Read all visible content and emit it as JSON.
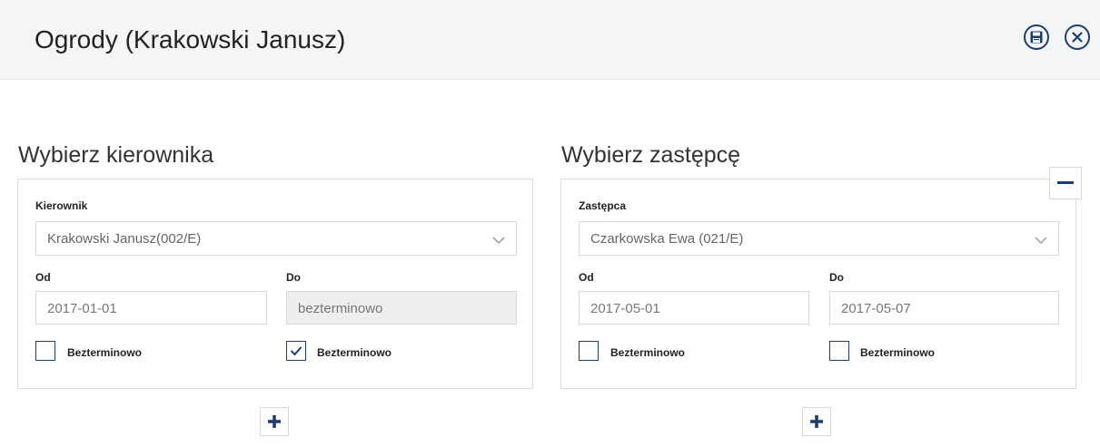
{
  "header": {
    "title": "Ogrody (Krakowski Janusz)",
    "save_icon": "floppy-disk-icon",
    "close_icon": "close-icon"
  },
  "manager": {
    "section_title": "Wybierz kierownika",
    "select_label": "Kierownik",
    "select_value": "Krakowski Janusz(002/E)",
    "from_label": "Od",
    "from_value": "2017-01-01",
    "to_label": "Do",
    "to_value": "bezterminowo",
    "from_checkbox_label": "Bezterminowo",
    "from_checkbox_checked": false,
    "to_checkbox_label": "Bezterminowo",
    "to_checkbox_checked": true
  },
  "deputy": {
    "section_title": "Wybierz zastępcę",
    "select_label": "Zastępca",
    "select_value": "Czarkowska Ewa (021/E)",
    "from_label": "Od",
    "from_value": "2017-05-01",
    "to_label": "Do",
    "to_value": "2017-05-07",
    "from_checkbox_label": "Bezterminowo",
    "from_checkbox_checked": false,
    "to_checkbox_label": "Bezterminowo",
    "to_checkbox_checked": false
  },
  "colors": {
    "accent": "#1a3e74",
    "header_bg": "#f4f5f6",
    "border": "#d9d9d9"
  }
}
